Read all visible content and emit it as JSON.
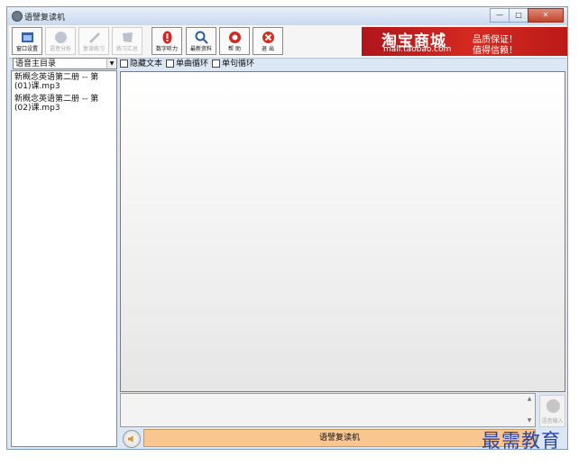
{
  "window": {
    "title": "语譬复读机",
    "controls": {
      "minimize": "—",
      "maximize": "□",
      "close": "✕"
    }
  },
  "toolbar": {
    "buttons": [
      {
        "label": "窗口设置",
        "icon": "window-settings-icon",
        "enabled": true
      },
      {
        "label": "语音分析",
        "icon": "voice-analysis-icon",
        "enabled": false
      },
      {
        "label": "复读练习",
        "icon": "repeat-practice-icon",
        "enabled": false
      },
      {
        "label": "练习汇总",
        "icon": "practice-summary-icon",
        "enabled": false
      },
      {
        "label": "数字听力",
        "icon": "digital-listening-icon",
        "enabled": true
      },
      {
        "label": "最新资料",
        "icon": "latest-material-icon",
        "enabled": true
      },
      {
        "label": "帮 助",
        "icon": "help-icon",
        "enabled": true
      },
      {
        "label": "退 出",
        "icon": "exit-icon",
        "enabled": true
      }
    ]
  },
  "banner": {
    "main": "淘宝商城",
    "url": "mall.taobao.com",
    "slogan_line1": "品质保证！",
    "slogan_line2": "值得信赖！"
  },
  "directory": {
    "selected": "语音主目录"
  },
  "options": [
    {
      "label": "隐藏文本",
      "checked": false
    },
    {
      "label": "单曲循环",
      "checked": false
    },
    {
      "label": "单句循环",
      "checked": false
    }
  ],
  "files": [
    "新概念英语第二册 -- 第(01)课.mp3",
    "新概念英语第二册 -- 第(02)课.mp3"
  ],
  "voice_input": {
    "label": "语音输入"
  },
  "status": {
    "text": "语譬复读机"
  },
  "watermark": "最需教育"
}
